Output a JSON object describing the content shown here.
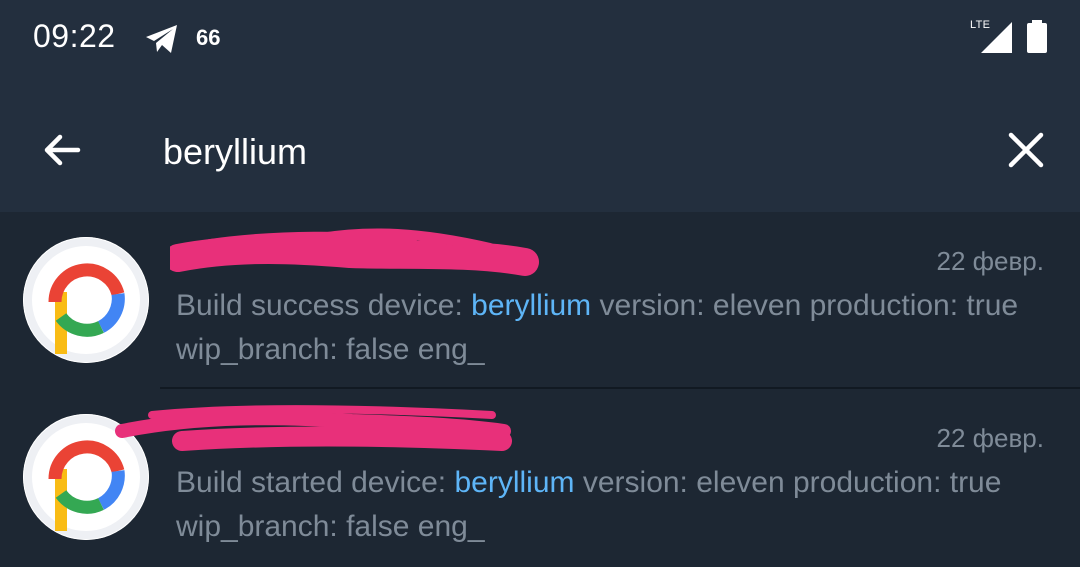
{
  "status_bar": {
    "time": "09:22",
    "notification_count": "66",
    "network": "LTE",
    "icons": [
      "telegram-icon",
      "signal-icon",
      "battery-icon"
    ]
  },
  "search": {
    "query": "beryllium"
  },
  "colors": {
    "background": "#1d2733",
    "toolbar": "#232f3e",
    "secondary_text": "#7f8b98",
    "highlight": "#5eb5f7",
    "redaction": "#e8307a"
  },
  "results": [
    {
      "title": "",
      "date": "22 февр.",
      "snippet_before": "Build success device: ",
      "snippet_match": "beryllium",
      "snippet_after": " version: eleven production: true wip_branch: false eng_",
      "avatar_icon": "pixel-experience-logo-icon"
    },
    {
      "title": "",
      "date": "22 февр.",
      "snippet_before": "Build started device: ",
      "snippet_match": "beryllium",
      "snippet_after": " version: eleven production: true wip_branch: false eng_",
      "avatar_icon": "pixel-experience-logo-icon"
    }
  ]
}
